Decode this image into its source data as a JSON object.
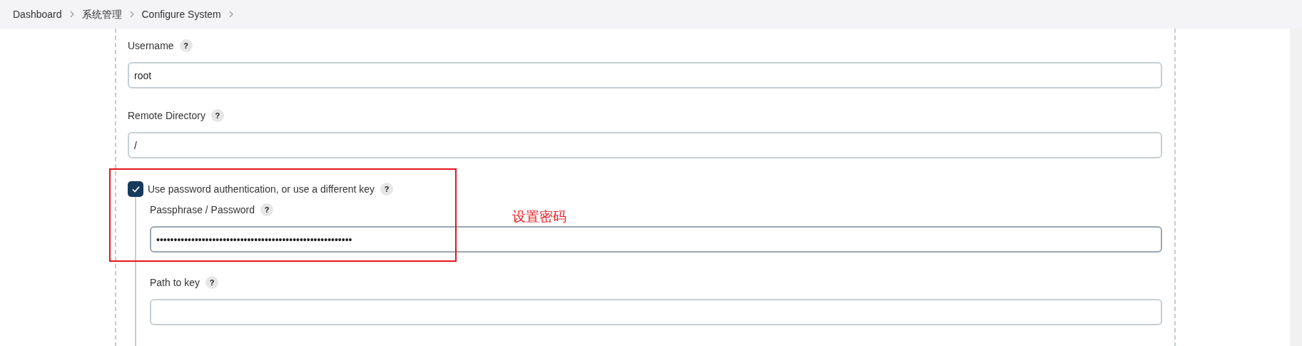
{
  "breadcrumbs": [
    "Dashboard",
    "系统管理",
    "Configure System"
  ],
  "fields": [
    {
      "label": "Username",
      "help": "?",
      "value": "root"
    },
    {
      "label": "Remote Directory",
      "help": "?",
      "value": "/"
    }
  ],
  "password_auth": {
    "label": "Use password authentication, or use a different key",
    "help": "?",
    "checked": true,
    "fields": [
      {
        "label": "Passphrase / Password",
        "help": "?",
        "value": "••••••••••••••••••••••••••••••••••••••••••••••••••••••••",
        "focused": true
      },
      {
        "label": "Path to key",
        "help": "?",
        "focused": false
      }
    ]
  },
  "annotation": {
    "text": "设置密码",
    "color": "#ee1c24"
  }
}
